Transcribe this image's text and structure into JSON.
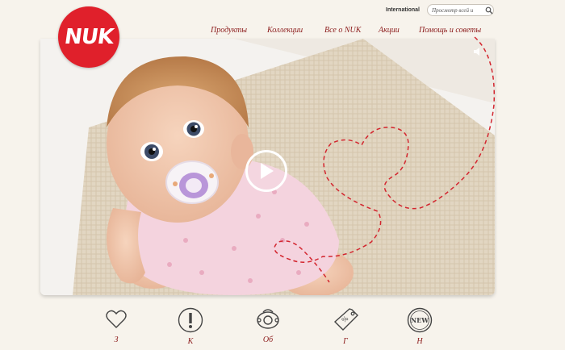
{
  "brand": {
    "logo_text": "NUK"
  },
  "header": {
    "international_label": "International",
    "search_placeholder": "Просмотр всей и"
  },
  "nav": {
    "items": [
      {
        "label": "Продукты"
      },
      {
        "label": "Коллекции"
      },
      {
        "label": "Все о NUK"
      },
      {
        "label": "Акции"
      },
      {
        "label": "Помощь и советы"
      }
    ]
  },
  "hero": {
    "play_icon": "play-icon",
    "sound_icon": "speaker-muted-icon"
  },
  "features": [
    {
      "icon": "heart-icon",
      "label": "З"
    },
    {
      "icon": "exclamation-icon",
      "label": "К"
    },
    {
      "icon": "pacifier-icon",
      "label": "Об"
    },
    {
      "icon": "price-tag-icon",
      "label": "Г"
    },
    {
      "icon": "new-badge-icon",
      "label": "Н"
    }
  ],
  "colors": {
    "brand_red": "#e0202b",
    "nav_text": "#8b1a1a",
    "page_bg": "#f7f3ec"
  }
}
